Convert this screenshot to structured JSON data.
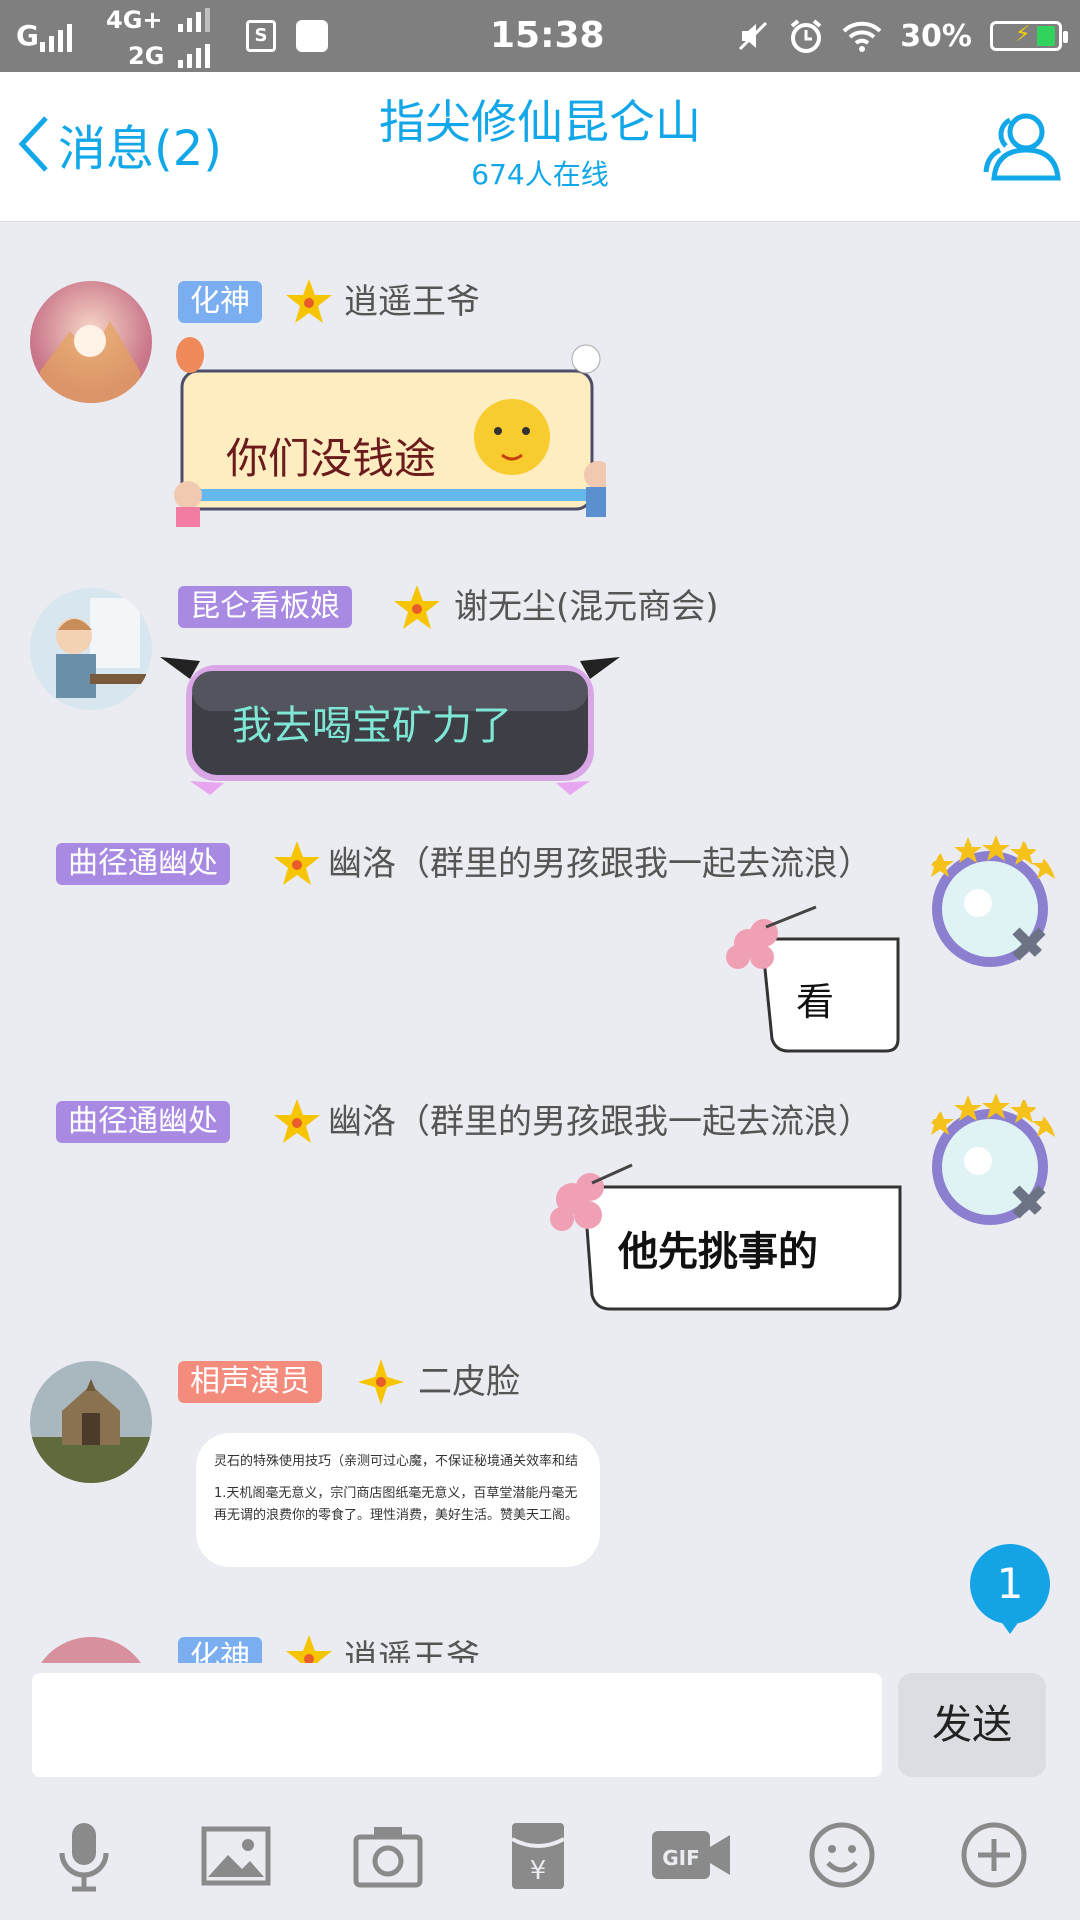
{
  "status_bar": {
    "network_1": "G",
    "network_2": "4G+",
    "network_3": "2G",
    "sim_icon": "S",
    "time": "15:38",
    "battery_percent": "30%",
    "battery_level": 0.3,
    "icons": [
      "signal-icon",
      "s-app-icon",
      "bag-icon",
      "mute-icon",
      "alarm-icon",
      "wifi-icon",
      "battery-icon"
    ]
  },
  "header": {
    "back_label": "消息(2)",
    "title": "指尖修仙昆仑山",
    "subtitle": "674人在线"
  },
  "messages": [
    {
      "badge": "化神",
      "badge_color": "#7aaef0",
      "name": "逍遥王爷",
      "sticker_text": "你们没钱途"
    },
    {
      "badge": "昆仑看板娘",
      "badge_color": "#a98ae3",
      "name": "谢无尘(混元商会)",
      "sticker_text": "我去喝宝矿力了"
    },
    {
      "badge": "曲径通幽处",
      "badge_color": "#a98ae3",
      "name": "幽洛（群里的男孩跟我一起去流浪）",
      "sticker_text": "看"
    },
    {
      "badge": "曲径通幽处",
      "badge_color": "#a98ae3",
      "name": "幽洛（群里的男孩跟我一起去流浪）",
      "sticker_text": "他先挑事的"
    },
    {
      "badge": "相声演员",
      "badge_color": "#f48c7e",
      "name": "二皮脸",
      "text_lines": [
        "灵石的特殊使用技巧（亲测可过心魔，不保证秘境通关效率和结",
        "1.天机阁毫无意义，宗门商店图纸毫无意义，百草堂潜能丹毫无",
        "再无谓的浪费你的零食了。理性消费，美好生活。赞美天工阁。"
      ]
    },
    {
      "badge": "化神",
      "badge_color": "#7aaef0",
      "name": "逍遥王爷"
    }
  ],
  "unread_count": "1",
  "input": {
    "placeholder": "",
    "value": "",
    "send_label": "发送"
  },
  "toolbar": [
    "microphone-icon",
    "image-icon",
    "camera-icon",
    "red-packet-icon",
    "gif-icon",
    "emoji-icon",
    "plus-icon"
  ],
  "colors": {
    "accent": "#12a7e8",
    "background": "#ebecf1",
    "status_bar": "#7f7f7f"
  }
}
